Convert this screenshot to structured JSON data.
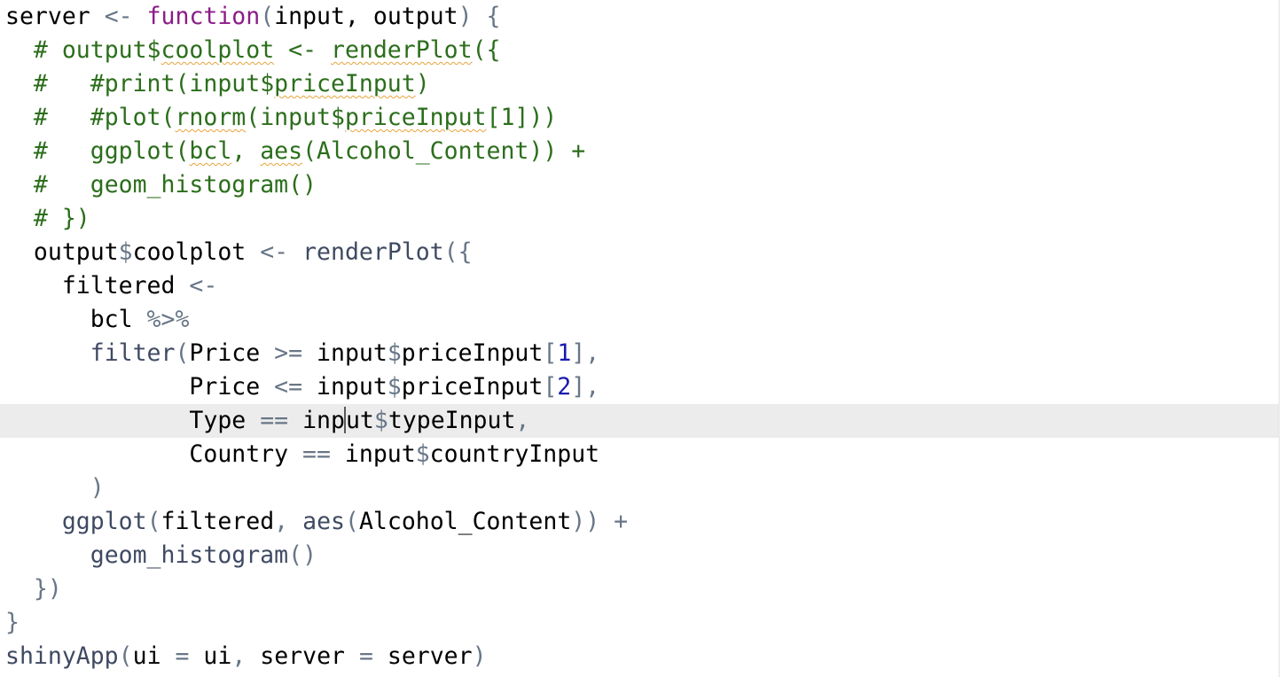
{
  "editor": {
    "language": "R",
    "active_line": 13,
    "colors": {
      "background": "#ffffff",
      "active_line": "#ececec",
      "keyword": "#8b1c87",
      "comment": "#2b6e1b",
      "operator": "#687687",
      "number": "#1a1ab0",
      "text": "#000000",
      "spellcheck_underline": "#e6a43a"
    },
    "lines": [
      [
        [
          "t",
          "server "
        ],
        [
          "o",
          "<-"
        ],
        [
          "t",
          " "
        ],
        [
          "k",
          "function"
        ],
        [
          "o",
          "("
        ],
        [
          "t",
          "input, output"
        ],
        [
          "o",
          ")"
        ],
        [
          "t",
          " "
        ],
        [
          "o",
          "{"
        ]
      ],
      [
        [
          "t",
          "  "
        ],
        [
          "c",
          "# output$"
        ],
        [
          "cs",
          "coolplot"
        ],
        [
          "c",
          " <- "
        ],
        [
          "cs",
          "renderPlot"
        ],
        [
          "c",
          "({"
        ]
      ],
      [
        [
          "t",
          "  "
        ],
        [
          "c",
          "#   #print(input$"
        ],
        [
          "cs",
          "priceInput"
        ],
        [
          "c",
          ")"
        ]
      ],
      [
        [
          "t",
          "  "
        ],
        [
          "c",
          "#   #plot("
        ],
        [
          "cs",
          "rnorm"
        ],
        [
          "c",
          "(input$"
        ],
        [
          "cs",
          "priceInput"
        ],
        [
          "c",
          "[1]))"
        ]
      ],
      [
        [
          "t",
          "  "
        ],
        [
          "c",
          "#   ggplot("
        ],
        [
          "cs",
          "bcl"
        ],
        [
          "c",
          ", "
        ],
        [
          "cs",
          "aes"
        ],
        [
          "c",
          "(Alcohol_Content)) +"
        ]
      ],
      [
        [
          "t",
          "  "
        ],
        [
          "c",
          "#   geom_histogram()"
        ]
      ],
      [
        [
          "t",
          "  "
        ],
        [
          "c",
          "# })"
        ]
      ],
      [
        [
          "t",
          "  output"
        ],
        [
          "d",
          "$"
        ],
        [
          "t",
          "coolplot "
        ],
        [
          "o",
          "<-"
        ],
        [
          "t",
          " "
        ],
        [
          "f",
          "renderPlot"
        ],
        [
          "o",
          "({"
        ]
      ],
      [
        [
          "t",
          "    filtered "
        ],
        [
          "o",
          "<-"
        ]
      ],
      [
        [
          "t",
          "      bcl "
        ],
        [
          "o",
          "%>%"
        ]
      ],
      [
        [
          "t",
          "      "
        ],
        [
          "f",
          "filter"
        ],
        [
          "o",
          "("
        ],
        [
          "t",
          "Price "
        ],
        [
          "o",
          ">="
        ],
        [
          "t",
          " input"
        ],
        [
          "d",
          "$"
        ],
        [
          "t",
          "priceInput"
        ],
        [
          "o",
          "["
        ],
        [
          "n",
          "1"
        ],
        [
          "o",
          "],"
        ]
      ],
      [
        [
          "t",
          "             Price "
        ],
        [
          "o",
          "<="
        ],
        [
          "t",
          " input"
        ],
        [
          "d",
          "$"
        ],
        [
          "t",
          "priceInput"
        ],
        [
          "o",
          "["
        ],
        [
          "n",
          "2"
        ],
        [
          "o",
          "],"
        ]
      ],
      [
        [
          "t",
          "             Type "
        ],
        [
          "o",
          "=="
        ],
        [
          "t",
          " inp"
        ],
        [
          "cur",
          ""
        ],
        [
          "t",
          "ut"
        ],
        [
          "d",
          "$"
        ],
        [
          "t",
          "typeInput"
        ],
        [
          "o",
          ","
        ]
      ],
      [
        [
          "t",
          "             Country "
        ],
        [
          "o",
          "=="
        ],
        [
          "t",
          " input"
        ],
        [
          "d",
          "$"
        ],
        [
          "t",
          "countryInput"
        ]
      ],
      [
        [
          "t",
          "      "
        ],
        [
          "o",
          ")"
        ]
      ],
      [
        [
          "t",
          "    "
        ],
        [
          "f",
          "ggplot"
        ],
        [
          "o",
          "("
        ],
        [
          "t",
          "filtered"
        ],
        [
          "o",
          ","
        ],
        [
          "t",
          " "
        ],
        [
          "f",
          "aes"
        ],
        [
          "o",
          "("
        ],
        [
          "t",
          "Alcohol_Content"
        ],
        [
          "o",
          "))"
        ],
        [
          "t",
          " "
        ],
        [
          "o",
          "+"
        ]
      ],
      [
        [
          "t",
          "      "
        ],
        [
          "f",
          "geom_histogram"
        ],
        [
          "o",
          "()"
        ]
      ],
      [
        [
          "t",
          "  "
        ],
        [
          "o",
          "})"
        ]
      ],
      [
        [
          "o",
          "}"
        ]
      ],
      [
        [
          "f",
          "shinyApp"
        ],
        [
          "o",
          "("
        ],
        [
          "t",
          "ui "
        ],
        [
          "o",
          "="
        ],
        [
          "t",
          " ui"
        ],
        [
          "o",
          ","
        ],
        [
          "t",
          " server "
        ],
        [
          "o",
          "="
        ],
        [
          "t",
          " server"
        ],
        [
          "o",
          ")"
        ]
      ]
    ]
  }
}
